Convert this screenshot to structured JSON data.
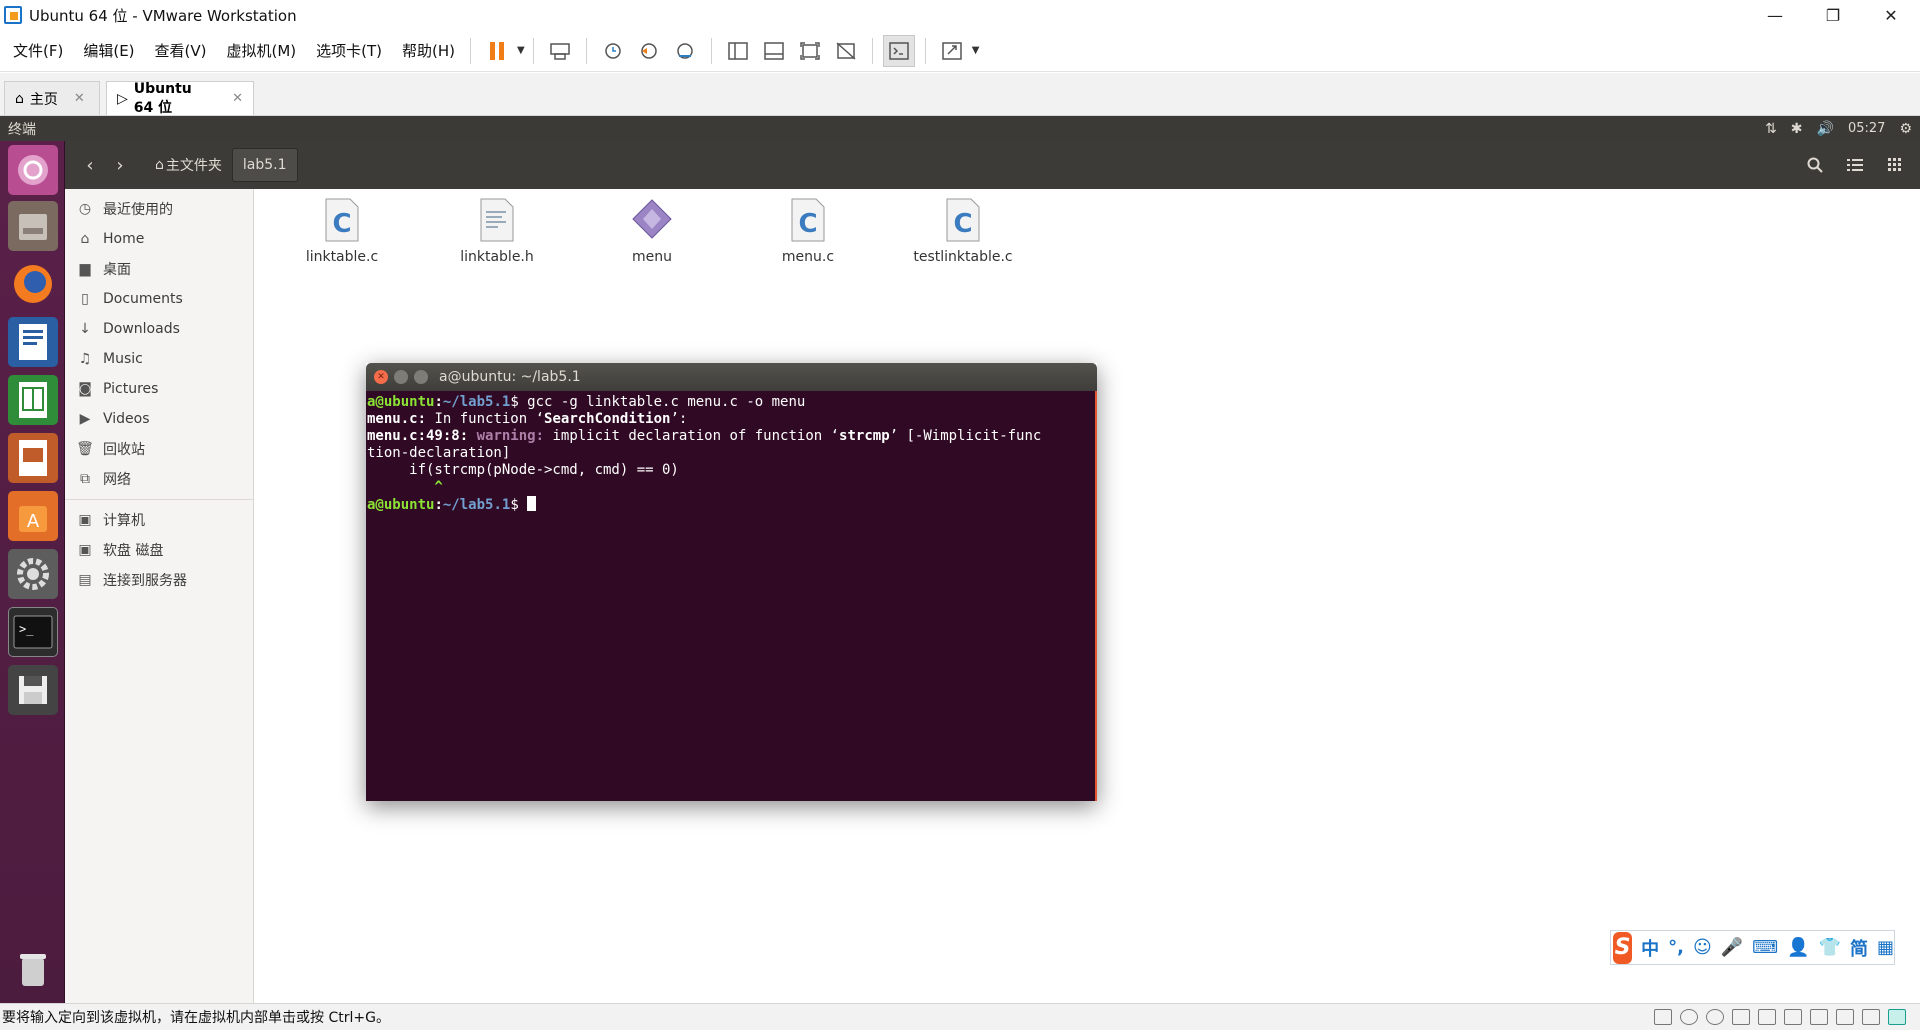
{
  "window": {
    "title": "Ubuntu 64 位 - VMware Workstation"
  },
  "menu": [
    "文件(F)",
    "编辑(E)",
    "查看(V)",
    "虚拟机(M)",
    "选项卡(T)",
    "帮助(H)"
  ],
  "tabs": [
    {
      "label": "主页"
    },
    {
      "label": "Ubuntu 64 位"
    }
  ],
  "ubuntu_panel": {
    "title": "终端",
    "time": "05:27"
  },
  "nautilus": {
    "path_home": "主文件夹",
    "path_current": "lab5.1",
    "sidebar": [
      {
        "label": "最近使用的",
        "icon": "clock-icon",
        "glyph": "◷"
      },
      {
        "label": "Home",
        "icon": "home-icon",
        "glyph": "⌂"
      },
      {
        "label": "桌面",
        "icon": "folder-icon",
        "glyph": "▆"
      },
      {
        "label": "Documents",
        "icon": "document-icon",
        "glyph": "▯"
      },
      {
        "label": "Downloads",
        "icon": "download-icon",
        "glyph": "↓"
      },
      {
        "label": "Music",
        "icon": "music-icon",
        "glyph": "♫"
      },
      {
        "label": "Pictures",
        "icon": "camera-icon",
        "glyph": "◙"
      },
      {
        "label": "Videos",
        "icon": "video-icon",
        "glyph": "▶"
      },
      {
        "label": "回收站",
        "icon": "trash-icon",
        "glyph": "🗑"
      },
      {
        "label": "网络",
        "icon": "network-icon",
        "glyph": "⧉"
      },
      {
        "label": "计算机",
        "icon": "computer-icon",
        "glyph": "▣"
      },
      {
        "label": "软盘 磁盘",
        "icon": "floppy-icon",
        "glyph": "▣"
      },
      {
        "label": "连接到服务器",
        "icon": "server-icon",
        "glyph": "▤"
      }
    ],
    "files": [
      {
        "name": "linktable.c",
        "type": "c-source"
      },
      {
        "name": "linktable.h",
        "type": "header"
      },
      {
        "name": "menu",
        "type": "executable"
      },
      {
        "name": "menu.c",
        "type": "c-source"
      },
      {
        "name": "testlinktable.c",
        "type": "c-source"
      }
    ]
  },
  "terminal": {
    "title": "a@ubuntu: ~/lab5.1",
    "prompt_user": "a@ubuntu",
    "prompt_path": "~/lab5.1",
    "command": "gcc -g linktable.c menu.c -o menu",
    "line2_file": "menu.c:",
    "line2_text": " In function ‘",
    "line2_func": "SearchCondition",
    "line2_end": "’:",
    "line3_loc": "menu.c:49:8:",
    "line3_warn": "warning:",
    "line3_text": " implicit declaration of function ‘",
    "line3_func": "strcmp",
    "line3_end": "’ [-Wimplicit-func",
    "line4": "tion-declaration]",
    "line5": "     if(strcmp(pNode->cmd, cmd) == 0)",
    "line6": "        ^"
  },
  "ime": {
    "items": [
      "中",
      "°,",
      "☺",
      "🎤",
      "⌨",
      "👤",
      "👕",
      "简",
      "▦"
    ]
  },
  "statusbar": {
    "text": "要将输入定向到该虚拟机，请在虚拟机内部单击或按 Ctrl+G。"
  }
}
